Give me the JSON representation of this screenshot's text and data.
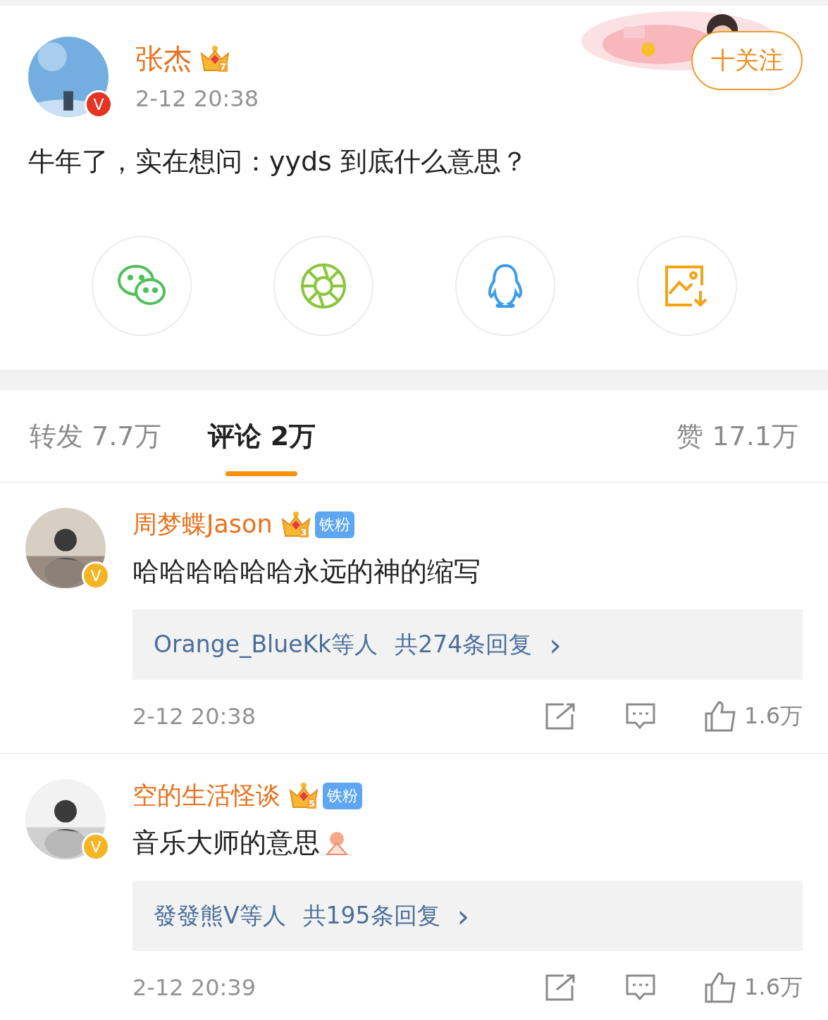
{
  "post": {
    "author": "张杰",
    "verified_mark": "V",
    "crown_level": "7",
    "time": "2-12 20:38",
    "follow_button": "十关注",
    "text": "牛年了，实在想问：yyds 到底什么意思？"
  },
  "share_buttons": [
    {
      "kind": "wechat"
    },
    {
      "kind": "moments"
    },
    {
      "kind": "qq"
    },
    {
      "kind": "save-image"
    }
  ],
  "tabs": [
    {
      "label": "转发 7.7万",
      "selected": false
    },
    {
      "label": "评论 2万",
      "selected": true
    },
    {
      "label": "赞 17.1万",
      "selected": false
    }
  ],
  "comments": [
    {
      "author": "周梦蝶Jason",
      "verified_mark": "V",
      "crown_level": "3",
      "fan_badge": "铁粉",
      "text": "哈哈哈哈哈哈永远的神的缩写",
      "emoji": false,
      "replies_by": "Orange_BlueKk等人",
      "replies_count": "共274条回复",
      "reply_arrow": "›",
      "time": "2-12 20:38",
      "likes": "1.6万"
    },
    {
      "author": "空的生活怪谈",
      "verified_mark": "V",
      "crown_level": "5",
      "fan_badge": "铁粉",
      "text": "音乐大师的意思",
      "emoji": true,
      "replies_by": "發發熊V等人",
      "replies_count": "共195条回复",
      "reply_arrow": "›",
      "time": "2-12 20:39",
      "likes": "1.6万"
    }
  ]
}
